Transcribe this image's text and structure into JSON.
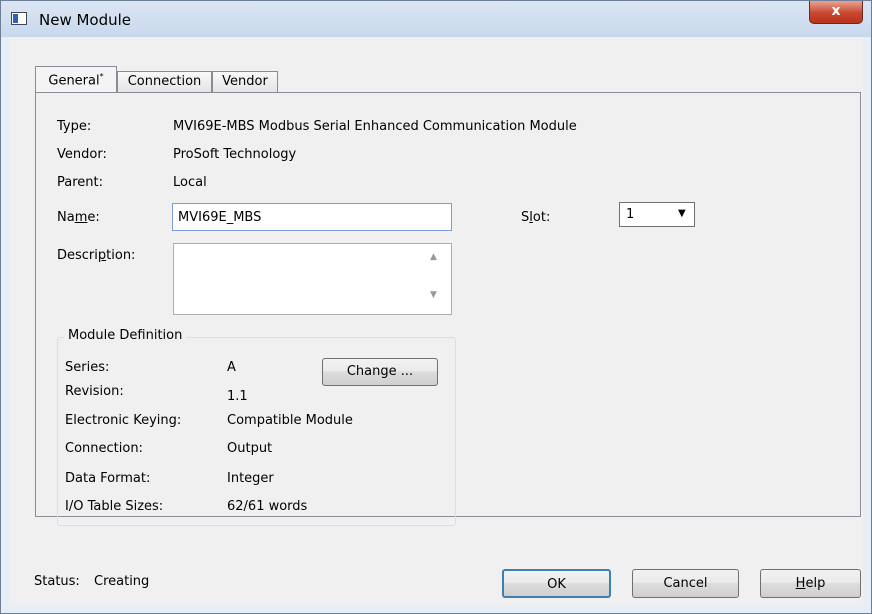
{
  "window": {
    "title": "New Module",
    "close_glyph": "x"
  },
  "tabs": [
    {
      "label": "General",
      "marker": "*"
    },
    {
      "label": "Connection"
    },
    {
      "label": "Vendor"
    }
  ],
  "general": {
    "type_label": "Type:",
    "type_value": "MVI69E-MBS Modbus Serial Enhanced Communication Module",
    "vendor_label": "Vendor:",
    "vendor_value": "ProSoft Technology",
    "parent_label": "Parent:",
    "parent_value": "Local",
    "name_label": {
      "pre": "Na",
      "accel": "m",
      "post": "e:"
    },
    "name_value": "MVI69E_MBS",
    "description_label": {
      "pre": "Descri",
      "accel": "p",
      "post": "tion:"
    },
    "description_value": "",
    "slot_label": {
      "pre": "S",
      "accel": "l",
      "post": "ot:"
    },
    "slot_value": "1"
  },
  "module_definition": {
    "legend": "Module Definition",
    "series_label": "Series:",
    "series_value": "A",
    "revision_label": "Revision:",
    "revision_value": "1.1",
    "keying_label": "Electronic Keying:",
    "keying_value": "Compatible Module",
    "connection_label": "Connection:",
    "connection_value": "Output",
    "data_format_label": "Data Format:",
    "data_format_value": "Integer",
    "io_label": "I/O Table Sizes:",
    "io_value": "62/61 words",
    "change_button": "Change ..."
  },
  "footer": {
    "status_label": "Status:",
    "status_value": "Creating",
    "ok_button": "OK",
    "cancel_button": "Cancel",
    "help_button": {
      "accel": "H",
      "post": "elp"
    }
  }
}
